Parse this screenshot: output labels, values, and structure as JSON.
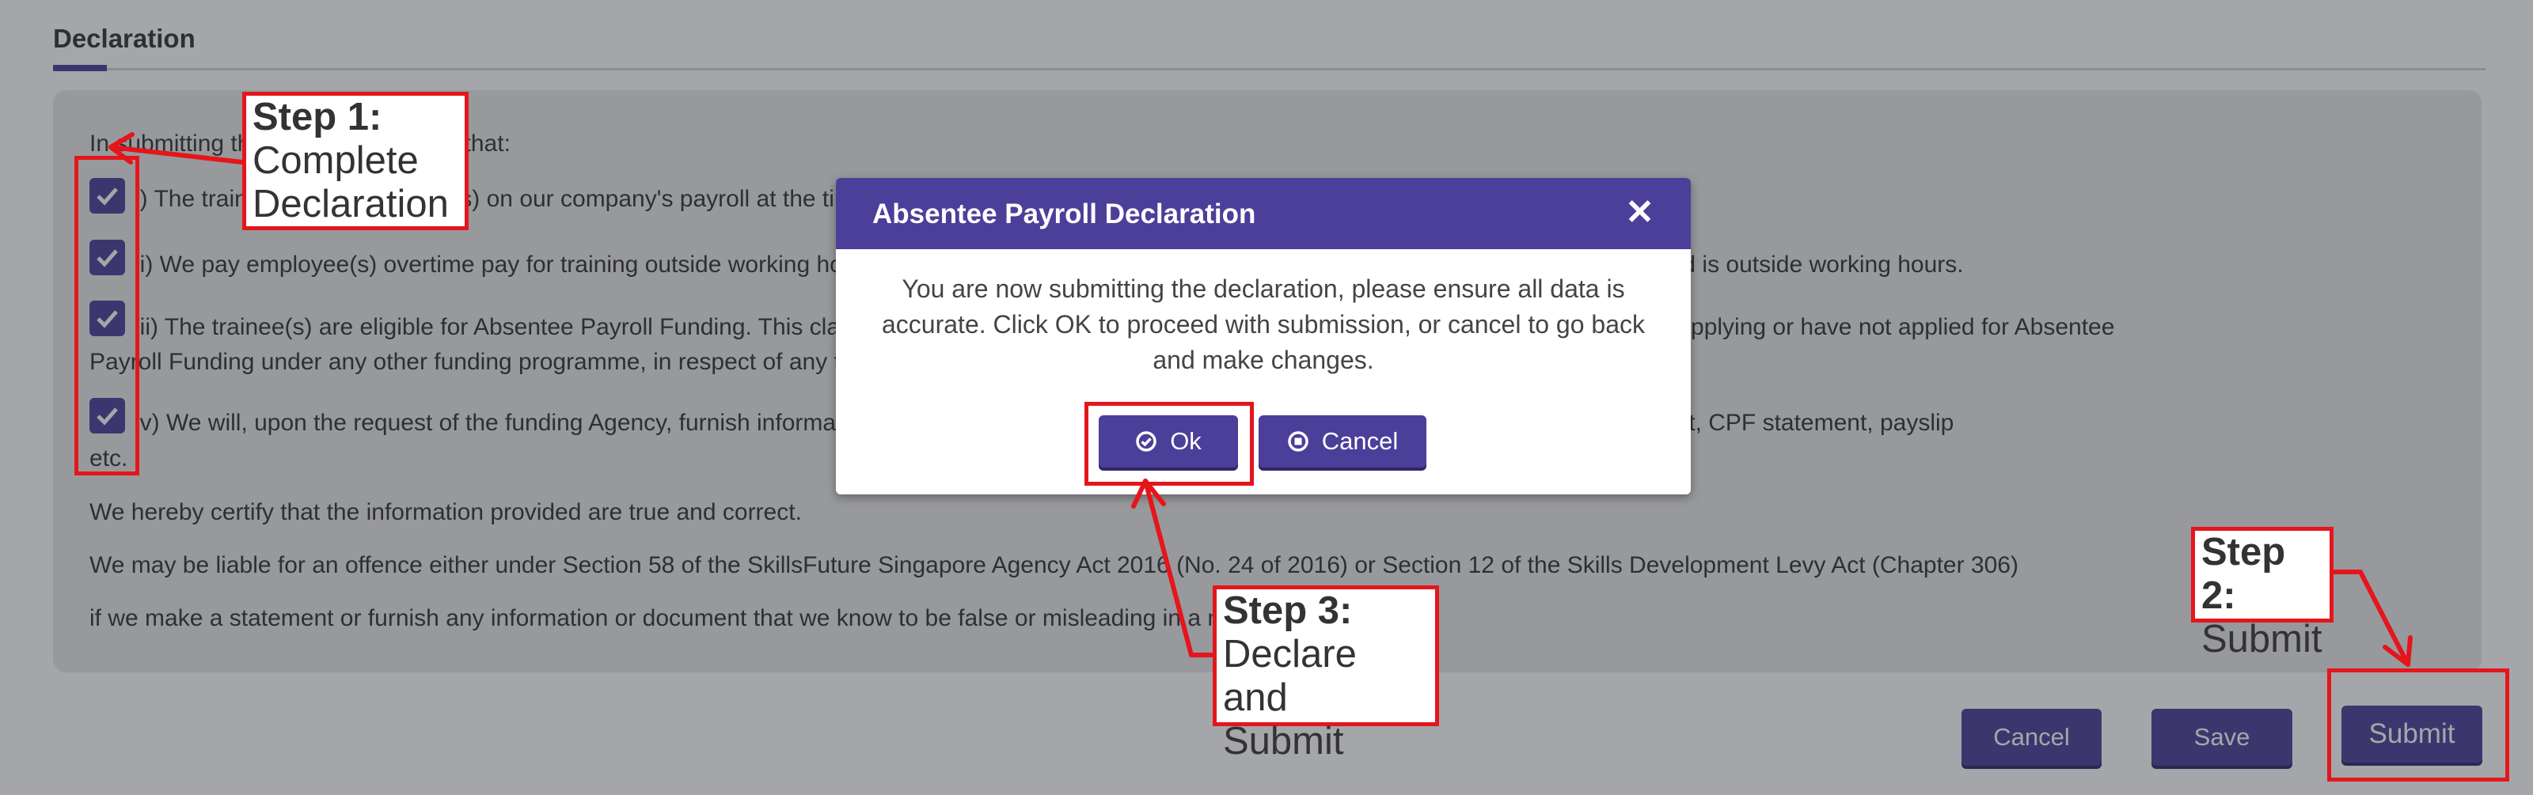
{
  "section": {
    "title": "Declaration"
  },
  "declaration": {
    "intro": "In submitting this claim, we declare that:",
    "items": [
      "i) The trainee(s) are employee(s) on our company's payroll at the time of training.",
      "ii) We pay employee(s) overtime pay for training outside working hours, in accordance with the Employment Act, where part of the training conducted is outside working hours.",
      "iii) The trainee(s) are eligible for Absentee Payroll Funding. This claim is made in respect of trainees who have completed each course. We are not applying or have not applied for Absentee",
      "iv) We will, upon the request of the funding Agency, furnish information and documents to support this claim, which may include employment contract, CPF statement, payslip"
    ],
    "item3_cont": "Payroll Funding under any other funding programme, in respect of any trainee.",
    "item4_cont": "etc.",
    "certify": "We hereby certify that the information provided are true and correct.",
    "liable": "We may be liable for an offence either under Section 58 of the SkillsFuture Singapore Agency Act 2016 (No. 24 of 2016) or Section 12 of the Skills Development Levy Act  (Chapter 306)",
    "liable2": "if we make a statement or furnish any information or document that we know to be false or misleading in a material particular."
  },
  "footer": {
    "cancel": "Cancel",
    "save": "Save",
    "submit": "Submit"
  },
  "modal": {
    "title": "Absentee Payroll Declaration",
    "message": "You are now submitting the declaration, please ensure all data is accurate. Click OK to proceed with submission, or cancel to go back and make changes.",
    "ok": "Ok",
    "cancel": "Cancel"
  },
  "annotations": {
    "step1_title": "Step 1:",
    "step1_text1": "Complete",
    "step1_text2": "Declaration",
    "step2_title": "Step 2:",
    "step2_text": "Submit",
    "step3_title": "Step 3:",
    "step3_text1": "Declare and",
    "step3_text2": "Submit"
  },
  "colors": {
    "accent": "#4b3f9a",
    "annotation": "#e4161c"
  }
}
